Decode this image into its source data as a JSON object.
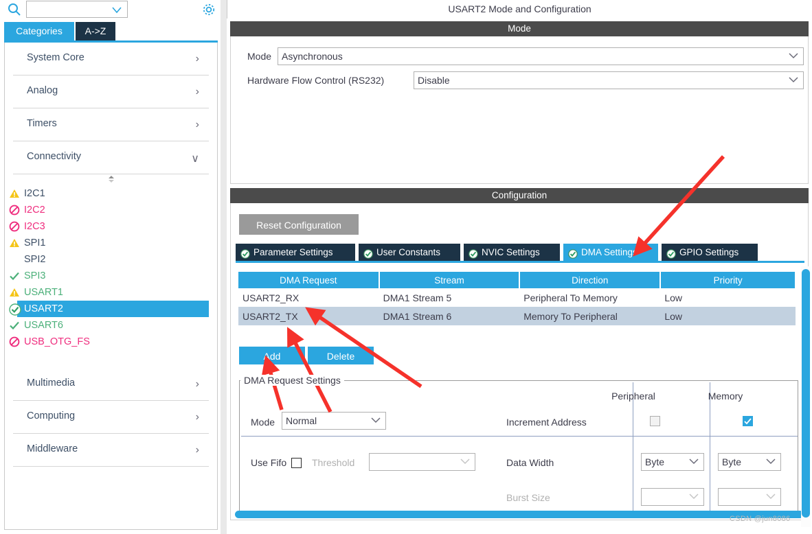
{
  "sidebar": {
    "search": {
      "placeholder": "",
      "value": "",
      "icon": "search-icon"
    },
    "gear_icon": "gear-icon",
    "tabs": [
      {
        "label": "Categories",
        "active": true
      },
      {
        "label": "A->Z",
        "active": false
      }
    ],
    "categories_top": [
      {
        "label": "System Core",
        "chevron": "›"
      },
      {
        "label": "Analog",
        "chevron": "›"
      },
      {
        "label": "Timers",
        "chevron": "›"
      },
      {
        "label": "Connectivity",
        "chevron": "∨"
      }
    ],
    "peripherals": [
      {
        "label": "I2C1",
        "status": "warning",
        "text_color": "#3d4f66"
      },
      {
        "label": "I2C2",
        "status": "disabled",
        "text_color": "#ef2d7e"
      },
      {
        "label": "I2C3",
        "status": "disabled",
        "text_color": "#ef2d7e"
      },
      {
        "label": "SPI1",
        "status": "warning",
        "text_color": "#3d4f66"
      },
      {
        "label": "SPI2",
        "status": "none",
        "text_color": "#3d4f66"
      },
      {
        "label": "SPI3",
        "status": "ok",
        "text_color": "#4cb07a"
      },
      {
        "label": "USART1",
        "status": "warning",
        "text_color": "#4cb07a"
      },
      {
        "label": "USART2",
        "status": "selected",
        "text_color": "#ffffff"
      },
      {
        "label": "USART6",
        "status": "ok",
        "text_color": "#4cb07a"
      },
      {
        "label": "USB_OTG_FS",
        "status": "disabled",
        "text_color": "#ef2d7e"
      }
    ],
    "categories_bottom": [
      {
        "label": "Multimedia",
        "chevron": "›"
      },
      {
        "label": "Computing",
        "chevron": "›"
      },
      {
        "label": "Middleware",
        "chevron": "›"
      }
    ]
  },
  "main": {
    "title": "USART2 Mode and Configuration",
    "mode_band": "Mode",
    "mode_form": [
      {
        "label": "Mode",
        "value": "Asynchronous"
      },
      {
        "label": "Hardware Flow Control (RS232)",
        "value": "Disable"
      }
    ],
    "config_band": "Configuration",
    "reset_button": "Reset Configuration",
    "tabs": [
      {
        "label": "Parameter Settings",
        "active": false
      },
      {
        "label": "User Constants",
        "active": false
      },
      {
        "label": "NVIC Settings",
        "active": false
      },
      {
        "label": "DMA Settings",
        "active": true
      },
      {
        "label": "GPIO Settings",
        "active": false
      }
    ],
    "dma_table": {
      "columns": [
        "DMA Request",
        "Stream",
        "Direction",
        "Priority"
      ],
      "rows": [
        {
          "request": "USART2_RX",
          "stream": "DMA1 Stream 5",
          "direction": "Peripheral To Memory",
          "priority": "Low",
          "selected": false
        },
        {
          "request": "USART2_TX",
          "stream": "DMA1 Stream 6",
          "direction": "Memory To Peripheral",
          "priority": "Low",
          "selected": true
        }
      ]
    },
    "buttons": {
      "add": "Add",
      "delete": "Delete"
    },
    "settings_group": {
      "title": "DMA Request Settings",
      "col_peripheral": "Peripheral",
      "col_memory": "Memory",
      "mode_label": "Mode",
      "mode_value": "Normal",
      "increment_address_label": "Increment Address",
      "increment_peripheral_checked": false,
      "increment_memory_checked": true,
      "use_fifo_label": "Use Fifo",
      "use_fifo_checked": false,
      "threshold_label": "Threshold",
      "threshold_value": "",
      "data_width_label": "Data Width",
      "data_width_peripheral": "Byte",
      "data_width_memory": "Byte",
      "burst_size_label": "Burst Size",
      "burst_peripheral": "",
      "burst_memory": ""
    }
  },
  "watermark": "CSDN @jun8086",
  "colors": {
    "accent_blue": "#2ba6df",
    "tab_dark": "#1c3346",
    "band_gray": "#4b4b4b",
    "row_selected": "#c2d1e0",
    "pink_disabled": "#ef2d7e",
    "green_ok": "#4cb07a",
    "warn_yellow": "#f5c518",
    "arrow_red": "#f5322b"
  }
}
